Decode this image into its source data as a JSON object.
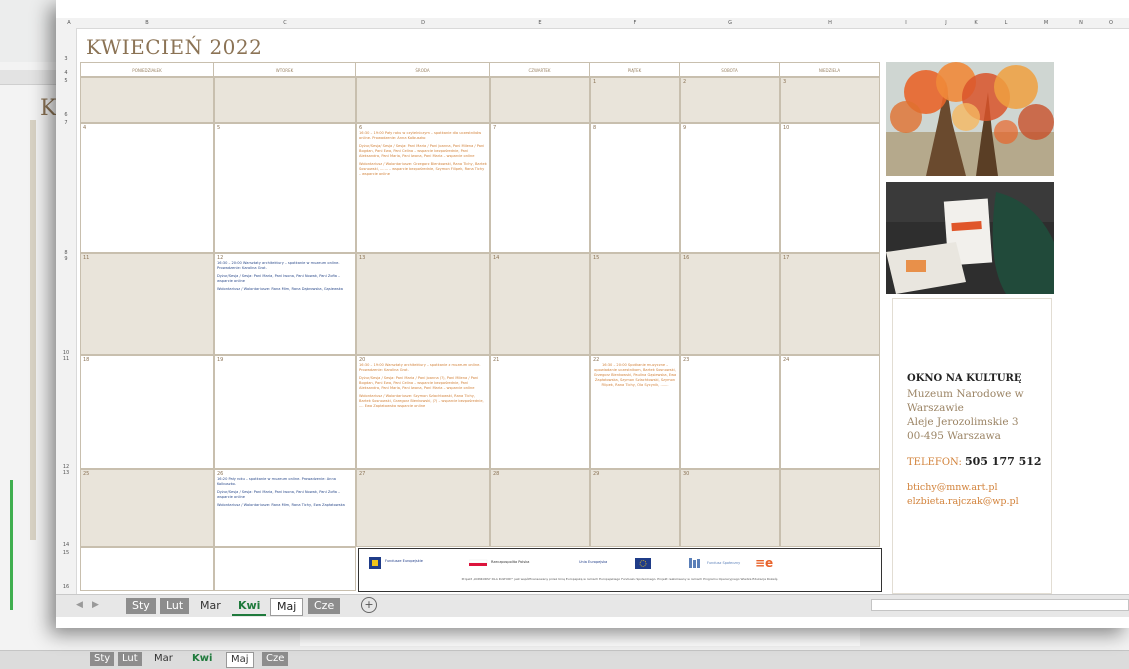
{
  "month_title": "KWIECIEŃ 2022",
  "back_title": "K",
  "columns": [
    "A",
    "B",
    "C",
    "D",
    "E",
    "F",
    "G",
    "H",
    "I",
    "J",
    "K",
    "L",
    "M",
    "N",
    "O"
  ],
  "rows": [
    "3",
    "4",
    "5",
    "6",
    "7",
    "8",
    "9",
    "10",
    "11",
    "12",
    "13",
    "14",
    "15",
    "16"
  ],
  "weekdays": [
    "PONIEDZIAŁEK",
    "WTOREK",
    "ŚRODA",
    "CZWARTEK",
    "PIĄTEK",
    "SOBOTA",
    "NIEDZIELA"
  ],
  "days": {
    "r0": [
      "",
      "",
      "",
      "",
      "1",
      "2",
      "3"
    ],
    "r1": [
      "4",
      "5",
      "6",
      "7",
      "8",
      "9",
      "10"
    ],
    "r2": [
      "11",
      "12",
      "13",
      "14",
      "15",
      "16",
      "17"
    ],
    "r3": [
      "18",
      "19",
      "20",
      "21",
      "22",
      "23",
      "24"
    ],
    "r4": [
      "25",
      "26",
      "27",
      "28",
      "29",
      "30",
      ""
    ]
  },
  "events": {
    "wed6": [
      "16:30 – 19:00 Pały roku w czytelniczym – spotkanie dla uczestników online. Prowadzenie: Anna Kolbuszko",
      "Dyżur/Sesja/ Sesja / Sesja: Pani Maria / Pani Joanna, Pani Milena / Pani Bogdan, Pani Ewa, Pani Celina – wsparcie bezpośrednie, Pani Aleksandra, Pani Maria, Pani Iwona, Pani Maria – wsparcie online",
      "Wolontariusz / Wolontariusze: Grzegorz Bienkowski, Rana Tichy, Bartek Sosnowski, ....... – wsparcie bezpośrednie, Szymon Filipek, Rana Tichy – wsparcie online"
    ],
    "tue12": [
      "16:30 – 20:00 Warsztaty architektury – spotkanie w muzeum online. Prowadzenie: Karolina Grot.",
      "Dyżur/Sesja / Sesja: Pani Maria, Pani Iwona, Pani Nowak, Pani Zofia – wsparcie online",
      "Wolontariusz / Wolontariusze: Rana Mim, Rana Dąbrowska, Gąsiewska"
    ],
    "wed20": [
      "16:30 – 19:00 Warsztaty architektury – spotkanie z muzeum online. Prowadzenie: Karolina Grot.",
      "Dyżur/Sesja / Sesja: Pani Maria / Pani Joanna (?), Pani Milena / Pani Bogdan, Pani Ewa, Pani Celina – wsparcie bezpośrednie, Pani Aleksandra, Pani Maria, Pani Iwona, Pani Maria – wsparcie online",
      "Wolontariusz / Wolontariusze: Szymon Szlachtowski, Rana Tichy, Bartek Sosnowski, Grzegorz Bienkowski, (?) – wsparcie bezpośrednie, .... Ewa Zapłatowska wsparcie online"
    ],
    "fri22": [
      "16:30 – 20:00 Spotkanie muzyczne – opowiadanie uczestnikom, Bartek Sosnowski, Grzegorz Bienkowski, Paulina Gąsiewska, Ewa Zapłatowska, Szymon Szlachtowski, Szymon Filipek, Rana Tichy, Ola Sycynik, ......."
    ],
    "tue26": [
      "16:20 Pały roku – spotkanie w muzeum online. Prowadzenie: Anna Kolbuszko.",
      "Dyżur/Sesja / Sesja: Pani Maria, Pani Iwona, Pani Nowak, Pani Zofia – wsparcie online",
      "Wolontariusz / Wolontariusze: Rana Mim, Rana Tichy, Ewa Zapłatowska"
    ]
  },
  "footer": {
    "logos": [
      "Fundusze Europejskie",
      "Rzeczpospolita Polska",
      "Unia Europejska",
      "Fundusz Społeczny"
    ],
    "text": "Projekt „KONKURSY DLA KULTURY” jest współfinansowany przez Unię Europejską w ramach Europejskiego Funduszu Społecznego. Projekt realizowany w ramach Programu Operacyjnego Wiedza Edukacja Rozwój."
  },
  "info": {
    "title": "OKNO NA KULTURĘ",
    "lines": [
      "Muzeum Narodowe w",
      "Warszawie",
      "Aleje Jerozolimskie 3",
      "00-495 Warszawa"
    ],
    "tel_label": "TELEFON:",
    "tel": "505 177 512",
    "emails": [
      "btichy@mnw.art.pl",
      "elzbieta.rajczak@wp.pl"
    ]
  },
  "tabs": [
    "Sty",
    "Lut",
    "Mar",
    "Kwi",
    "Maj",
    "Cze"
  ],
  "add_tab": "+",
  "colors": {
    "accent": "#8b7355",
    "orange": "#d2823a",
    "blue": "#2c4b8b",
    "shade": "#e9e4da",
    "green": "#1f7a3c"
  }
}
